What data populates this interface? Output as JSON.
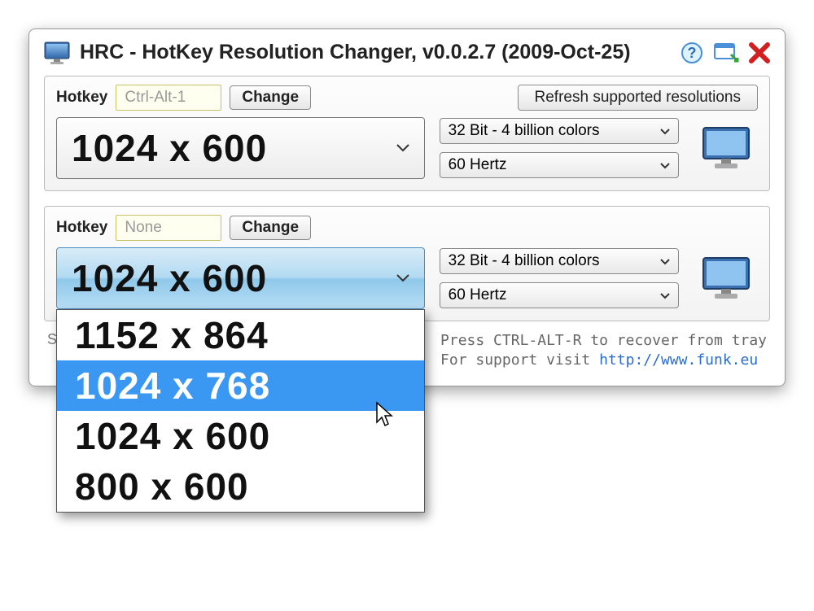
{
  "title": "HRC - HotKey Resolution Changer, v0.0.2.7 (2009-Oct-25)",
  "slot1": {
    "hotkey_label": "Hotkey",
    "hotkey_value": "Ctrl-Alt-1",
    "change_label": "Change",
    "refresh_label": "Refresh supported resolutions",
    "resolution": "1024 x 600",
    "color_depth": "32 Bit - 4 billion colors",
    "refresh_rate": "60 Hertz"
  },
  "slot2": {
    "hotkey_label": "Hotkey",
    "hotkey_value": "None",
    "change_label": "Change",
    "resolution": "1024 x 600",
    "color_depth": "32 Bit - 4 billion colors",
    "refresh_rate": "60 Hertz",
    "dropdown_options": [
      "1152 x 864",
      "1024 x 768",
      "1024 x 600",
      "800 x 600"
    ],
    "dropdown_highlight_index": 1
  },
  "footer": {
    "left_initial": "S",
    "recover_text": "Press CTRL-ALT-R to recover from tray",
    "support_text": "For support visit ",
    "support_url_label": "http://www.funk.eu"
  }
}
